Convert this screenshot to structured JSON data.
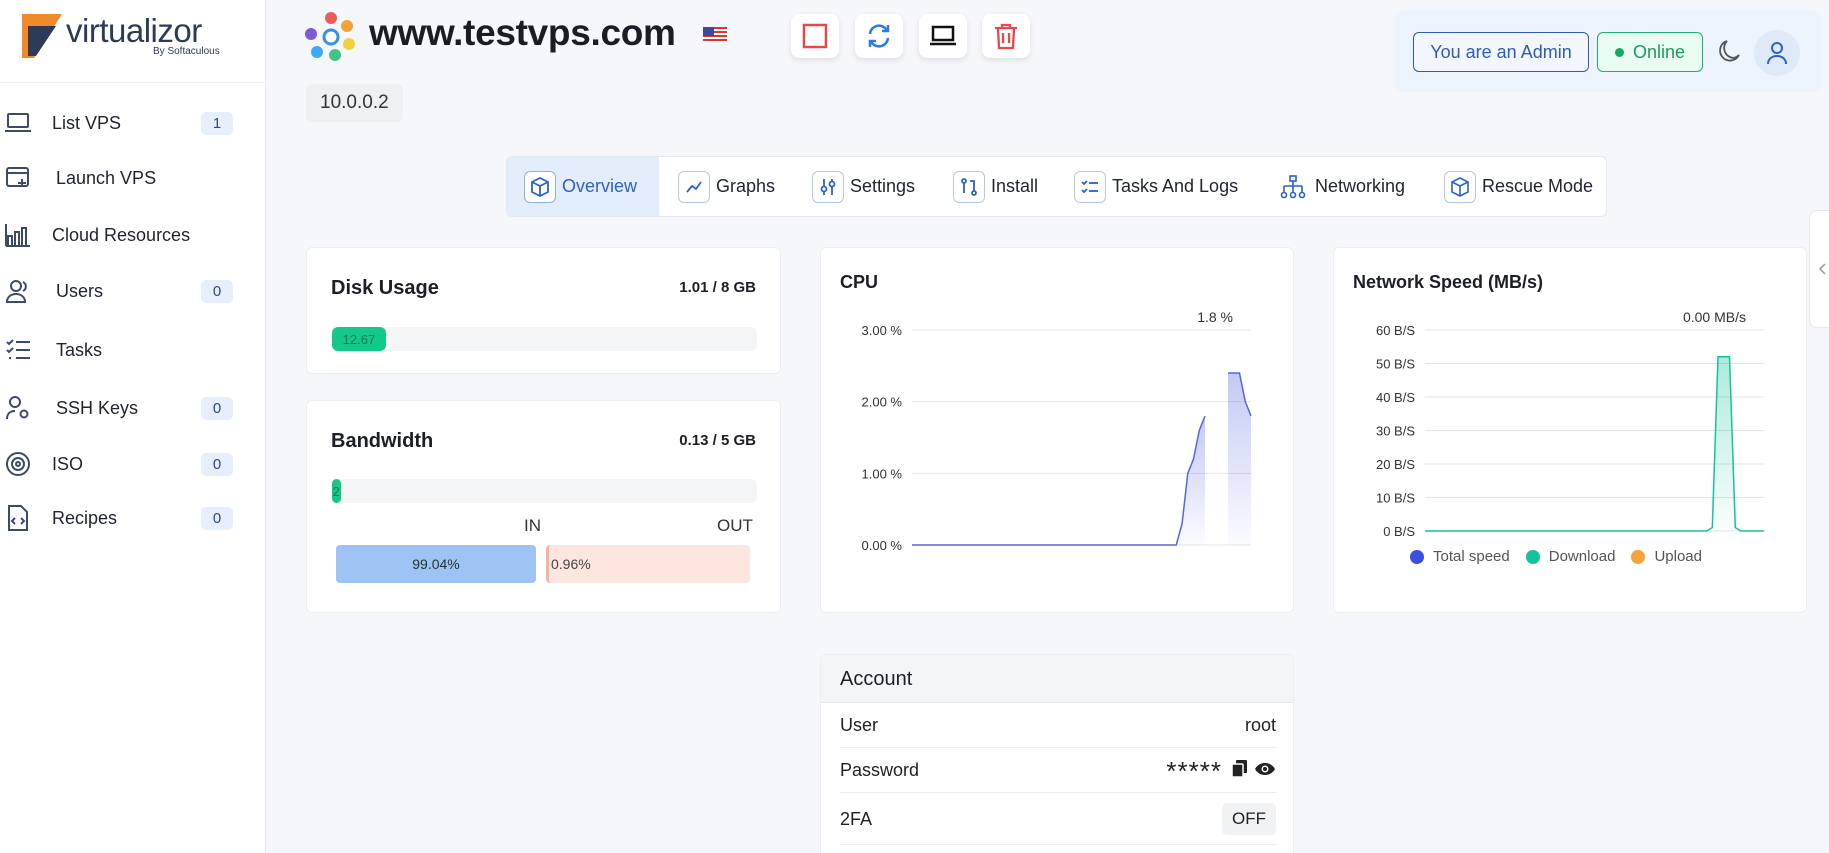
{
  "sidebar": {
    "brand": "virtualizor",
    "brand_sub": "By Softaculous",
    "items": [
      {
        "label": "List VPS",
        "badge": "1",
        "icon": "laptop-icon"
      },
      {
        "label": "Launch VPS",
        "badge": "",
        "icon": "window-plus-icon"
      },
      {
        "label": "Cloud Resources",
        "badge": "",
        "icon": "bar-chart-icon"
      },
      {
        "label": "Users",
        "badge": "0",
        "icon": "users-icon"
      },
      {
        "label": "Tasks",
        "badge": "",
        "icon": "checklist-icon"
      },
      {
        "label": "SSH Keys",
        "badge": "0",
        "icon": "user-key-icon"
      },
      {
        "label": "ISO",
        "badge": "0",
        "icon": "disc-icon"
      },
      {
        "label": "Recipes",
        "badge": "0",
        "icon": "code-file-icon"
      }
    ]
  },
  "header": {
    "hostname": "www.testvps.com",
    "ip": "10.0.0.2",
    "controls": [
      "stop-icon",
      "restart-icon",
      "console-icon",
      "delete-icon"
    ]
  },
  "topright": {
    "admin_label": "You are an Admin",
    "status_label": "Online"
  },
  "tabs": [
    {
      "label": "Overview",
      "active": true
    },
    {
      "label": "Graphs"
    },
    {
      "label": "Settings"
    },
    {
      "label": "Install"
    },
    {
      "label": "Tasks And Logs"
    },
    {
      "label": "Networking"
    },
    {
      "label": "Rescue Mode"
    }
  ],
  "disk": {
    "title": "Disk Usage",
    "usage": "1.01 / 8 GB",
    "percent_label": "12.67",
    "percent": 12.67
  },
  "bandwidth": {
    "title": "Bandwidth",
    "usage": "0.13 / 5 GB",
    "percent_label": "2",
    "percent": 2,
    "in_label": "IN",
    "out_label": "OUT",
    "in_value": "99.04%",
    "out_value": "0.96%",
    "in_fraction": 0.9904
  },
  "chart_data": [
    {
      "type": "area",
      "title": "CPU",
      "current": "1.8 %",
      "yticks": [
        "3.00 %",
        "2.00 %",
        "1.00 %",
        "0.00 %"
      ],
      "ylim": [
        0,
        3
      ],
      "grid": true,
      "series": [
        {
          "values": [
            0,
            0,
            0,
            0,
            0,
            0,
            0,
            0,
            0,
            0,
            0,
            0,
            0,
            0,
            0,
            0,
            0,
            0,
            0,
            0,
            0,
            0,
            0,
            0,
            0,
            0,
            0,
            0,
            0,
            0,
            0,
            0,
            0,
            0,
            0,
            0,
            0,
            0,
            0,
            0,
            0,
            0,
            0,
            0,
            0,
            0,
            0,
            0.3,
            1.0,
            1.2,
            1.6,
            1.8,
            null,
            null,
            null,
            2.4,
            2.4,
            2.4,
            2.0,
            1.8
          ],
          "color": "#5566e0"
        }
      ]
    },
    {
      "type": "area",
      "title": "Network Speed (MB/s)",
      "current": "0.00 MB/s",
      "yticks": [
        "60 B/S",
        "50 B/S",
        "40 B/S",
        "30 B/S",
        "20 B/S",
        "10 B/S",
        "0 B/S"
      ],
      "ylim": [
        0,
        60
      ],
      "grid": true,
      "legend": [
        {
          "name": "Total speed",
          "color": "#3d4fe0"
        },
        {
          "name": "Download",
          "color": "#14c39a"
        },
        {
          "name": "Upload",
          "color": "#f7a23a"
        }
      ],
      "series": [
        {
          "name": "Download",
          "values": [
            0,
            0,
            0,
            0,
            0,
            0,
            0,
            0,
            0,
            0,
            0,
            0,
            0,
            0,
            0,
            0,
            0,
            0,
            0,
            0,
            0,
            0,
            0,
            0,
            0,
            0,
            0,
            0,
            0,
            0,
            0,
            0,
            0,
            0,
            0,
            0,
            0,
            0,
            0,
            0,
            0,
            0,
            0,
            0,
            0,
            0,
            0,
            0,
            0,
            0,
            1,
            52,
            52,
            52,
            1,
            0,
            0,
            0,
            0,
            0
          ],
          "color": "#14c39a"
        }
      ]
    }
  ],
  "account": {
    "title": "Account",
    "rows": [
      {
        "key": "User",
        "value": "root"
      },
      {
        "key": "Password",
        "value": "*****"
      },
      {
        "key": "2FA",
        "value": "OFF"
      }
    ]
  }
}
